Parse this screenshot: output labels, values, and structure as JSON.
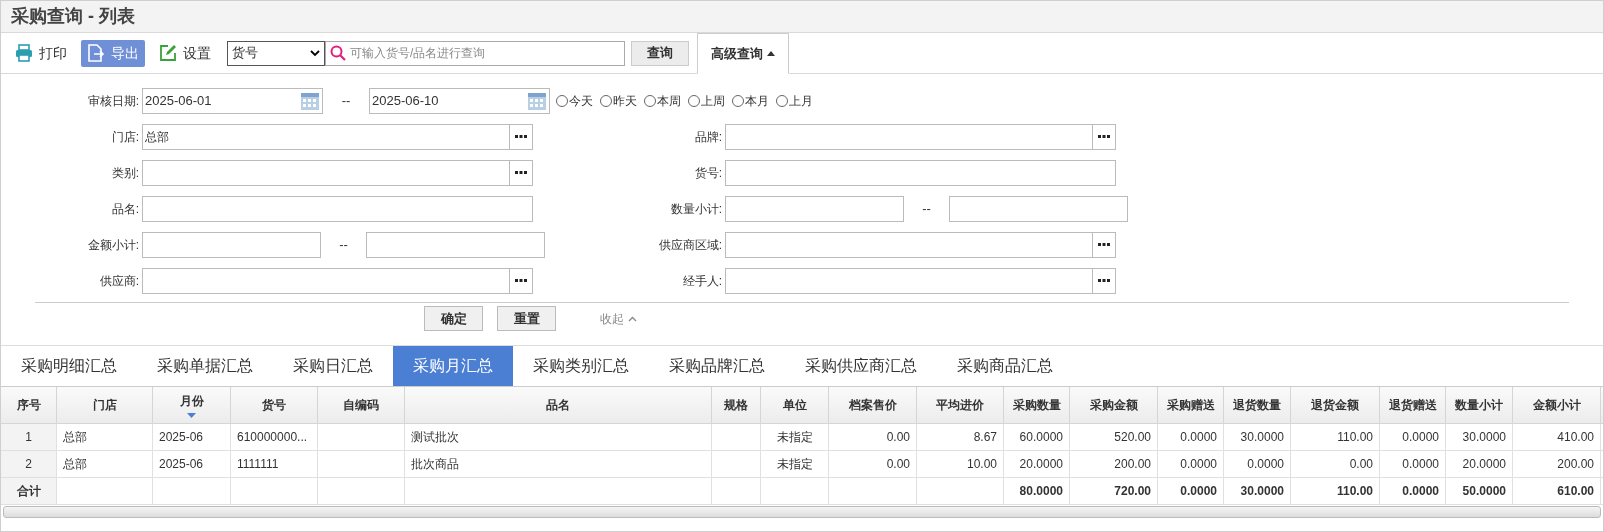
{
  "window": {
    "title": "采购查询 - 列表"
  },
  "toolbar": {
    "buttons": [
      {
        "label": "打印",
        "kind": "print",
        "highlighted": false
      },
      {
        "label": "导出",
        "kind": "export",
        "highlighted": true
      },
      {
        "label": "设置",
        "kind": "settings",
        "highlighted": false
      }
    ],
    "search_type": "货号",
    "search_placeholder": "可输入货号/品名进行查询",
    "query_button": "查询",
    "advanced": {
      "label": "高级查询",
      "expanded": true
    }
  },
  "form": {
    "date_range": {
      "label": "审核日期:",
      "from": "2025-06-01",
      "separator": "--",
      "to": "2025-06-10"
    },
    "quick_dates": [
      {
        "label": "今天",
        "selected": false
      },
      {
        "label": "昨天",
        "selected": false
      },
      {
        "label": "本周",
        "selected": false
      },
      {
        "label": "上周",
        "selected": false
      },
      {
        "label": "本月",
        "selected": false
      },
      {
        "label": "上月",
        "selected": false
      }
    ],
    "fields": [
      {
        "label": "门店:",
        "kind": "picker",
        "value": "总部"
      },
      {
        "label": "品牌:",
        "kind": "picker"
      },
      {
        "label": "类别:",
        "kind": "picker"
      },
      {
        "label": "货号:",
        "kind": "text"
      },
      {
        "label": "品名:",
        "kind": "text"
      },
      {
        "label": "数量小计:",
        "kind": "range",
        "separator": "--"
      },
      {
        "label": "金额小计:",
        "kind": "range",
        "separator": "--"
      },
      {
        "label": "供应商区域:",
        "kind": "picker"
      },
      {
        "label": "供应商:",
        "kind": "picker"
      },
      {
        "label": "经手人:",
        "kind": "picker"
      }
    ],
    "buttons": [
      "确定",
      "重置"
    ],
    "collapse": "收起"
  },
  "tabs": [
    {
      "label": "采购明细汇总",
      "selected": false
    },
    {
      "label": "采购单据汇总",
      "selected": false
    },
    {
      "label": "采购日汇总",
      "selected": false
    },
    {
      "label": "采购月汇总",
      "selected": true
    },
    {
      "label": "采购类别汇总",
      "selected": false
    },
    {
      "label": "采购品牌汇总",
      "selected": false
    },
    {
      "label": "采购供应商汇总",
      "selected": false
    },
    {
      "label": "采购商品汇总",
      "selected": false
    }
  ],
  "table": {
    "columns": [
      {
        "label": "序号",
        "kind": "index",
        "sorted": false
      },
      {
        "label": "门店",
        "kind": "text",
        "sorted": false
      },
      {
        "label": "月份",
        "kind": "text",
        "sorted": true
      },
      {
        "label": "货号",
        "kind": "text",
        "sorted": false
      },
      {
        "label": "自编码",
        "kind": "text",
        "sorted": false
      },
      {
        "label": "品名",
        "kind": "text",
        "sorted": false
      },
      {
        "label": "规格",
        "kind": "text",
        "sorted": false
      },
      {
        "label": "单位",
        "kind": "text",
        "sorted": false
      },
      {
        "label": "档案售价",
        "kind": "number",
        "sorted": false
      },
      {
        "label": "平均进价",
        "kind": "number",
        "sorted": false
      },
      {
        "label": "采购数量",
        "kind": "number",
        "sorted": false
      },
      {
        "label": "采购金额",
        "kind": "number",
        "sorted": false
      },
      {
        "label": "采购赠送",
        "kind": "number",
        "sorted": false
      },
      {
        "label": "退货数量",
        "kind": "number",
        "sorted": false
      },
      {
        "label": "退货金额",
        "kind": "number",
        "sorted": false
      },
      {
        "label": "退货赠送",
        "kind": "number",
        "sorted": false
      },
      {
        "label": "数量小计",
        "kind": "number",
        "sorted": false
      },
      {
        "label": "金额小计",
        "kind": "number",
        "sorted": false
      }
    ],
    "rows": [
      [
        "1",
        "总部",
        "2025-06",
        "610000000...",
        null,
        "测试批次",
        null,
        "未指定",
        "0.00",
        "8.67",
        "60.0000",
        "520.00",
        "0.0000",
        "30.0000",
        "110.00",
        "0.0000",
        "30.0000",
        "410.00"
      ],
      [
        "2",
        "总部",
        "2025-06",
        "1111111",
        null,
        "批次商品",
        null,
        "未指定",
        "0.00",
        "10.00",
        "20.0000",
        "200.00",
        "0.0000",
        "0.0000",
        "0.00",
        "0.0000",
        "20.0000",
        "200.00"
      ]
    ],
    "totals": {
      "label": "合计",
      "values": [
        "80.0000",
        "720.00",
        "0.0000",
        "30.0000",
        "110.00",
        "0.0000",
        "50.0000",
        "610.00"
      ]
    }
  }
}
